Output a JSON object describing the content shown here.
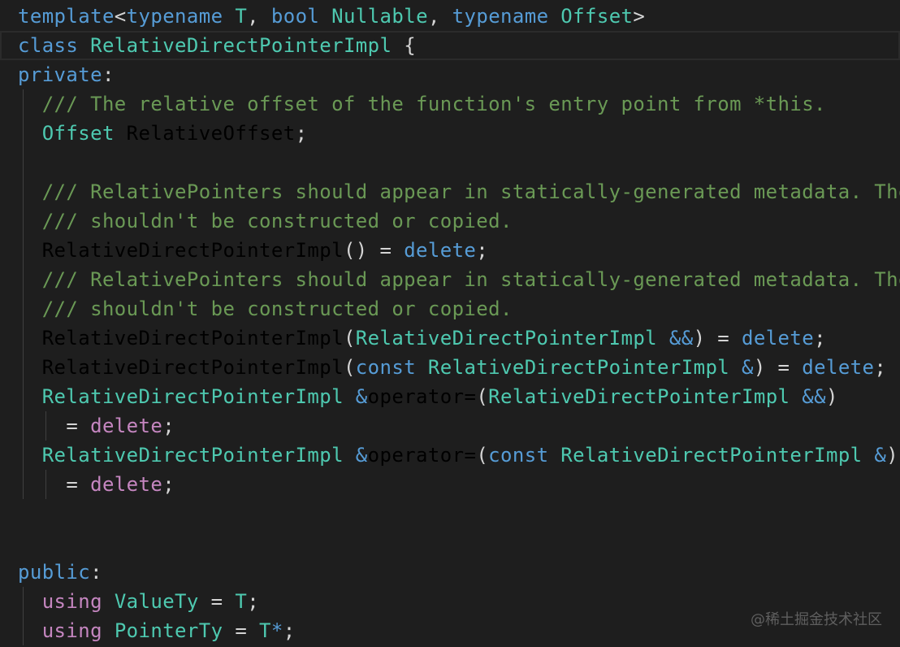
{
  "colors": {
    "background": "#1e1e1e",
    "keyword": "#569cd6",
    "type": "#4ec9b0",
    "text": "#d4d4d4",
    "comment": "#6a9955",
    "function": "#dcdcaa",
    "control": "#c586c0",
    "variable": "#9cdcfe",
    "guide": "#404040",
    "watermark": "#5f5f5f"
  },
  "watermark": "@稀土掘金技术社区",
  "code_lines": [
    {
      "indent": 0,
      "current": false,
      "tokens": [
        {
          "t": "template",
          "c": "keyword"
        },
        {
          "t": "<",
          "c": "text"
        },
        {
          "t": "typename",
          "c": "keyword"
        },
        {
          "t": " ",
          "c": "text"
        },
        {
          "t": "T",
          "c": "type"
        },
        {
          "t": ", ",
          "c": "text"
        },
        {
          "t": "bool",
          "c": "keyword"
        },
        {
          "t": " ",
          "c": "text"
        },
        {
          "t": "Nullable",
          "c": "type"
        },
        {
          "t": ", ",
          "c": "text"
        },
        {
          "t": "typename",
          "c": "keyword"
        },
        {
          "t": " ",
          "c": "text"
        },
        {
          "t": "Offset",
          "c": "type"
        },
        {
          "t": ">",
          "c": "text"
        }
      ]
    },
    {
      "indent": 0,
      "current": true,
      "tokens": [
        {
          "t": "class",
          "c": "keyword"
        },
        {
          "t": " ",
          "c": "text"
        },
        {
          "t": "RelativeDirectPointerImpl",
          "c": "type"
        },
        {
          "t": " {",
          "c": "text"
        }
      ]
    },
    {
      "indent": 0,
      "current": false,
      "tokens": [
        {
          "t": "private",
          "c": "keyword"
        },
        {
          "t": ":",
          "c": "text"
        }
      ]
    },
    {
      "indent": 1,
      "current": false,
      "tokens": [
        {
          "t": "/// The relative offset of the function's entry point from *this.",
          "c": "comment"
        }
      ]
    },
    {
      "indent": 1,
      "current": false,
      "tokens": [
        {
          "t": "Offset",
          "c": "type"
        },
        {
          "t": " ",
          "c": "text"
        },
        {
          "t": "RelativeOffset",
          "c": "variable"
        },
        {
          "t": ";",
          "c": "text"
        }
      ]
    },
    {
      "indent": 1,
      "current": false,
      "tokens": []
    },
    {
      "indent": 1,
      "current": false,
      "tokens": [
        {
          "t": "/// RelativePointers should appear in statically-generated metadata. They",
          "c": "comment"
        }
      ]
    },
    {
      "indent": 1,
      "current": false,
      "tokens": [
        {
          "t": "/// shouldn't be constructed or copied.",
          "c": "comment"
        }
      ]
    },
    {
      "indent": 1,
      "current": false,
      "tokens": [
        {
          "t": "RelativeDirectPointerImpl",
          "c": "function"
        },
        {
          "t": "() = ",
          "c": "text"
        },
        {
          "t": "delete",
          "c": "keyword"
        },
        {
          "t": ";",
          "c": "text"
        }
      ]
    },
    {
      "indent": 1,
      "current": false,
      "tokens": [
        {
          "t": "/// RelativePointers should appear in statically-generated metadata. They",
          "c": "comment"
        }
      ]
    },
    {
      "indent": 1,
      "current": false,
      "tokens": [
        {
          "t": "/// shouldn't be constructed or copied.",
          "c": "comment"
        }
      ]
    },
    {
      "indent": 1,
      "current": false,
      "tokens": [
        {
          "t": "RelativeDirectPointerImpl",
          "c": "function"
        },
        {
          "t": "(",
          "c": "text"
        },
        {
          "t": "RelativeDirectPointerImpl",
          "c": "type"
        },
        {
          "t": " ",
          "c": "text"
        },
        {
          "t": "&&",
          "c": "keyword"
        },
        {
          "t": ") = ",
          "c": "text"
        },
        {
          "t": "delete",
          "c": "keyword"
        },
        {
          "t": ";",
          "c": "text"
        }
      ]
    },
    {
      "indent": 1,
      "current": false,
      "tokens": [
        {
          "t": "RelativeDirectPointerImpl",
          "c": "function"
        },
        {
          "t": "(",
          "c": "text"
        },
        {
          "t": "const",
          "c": "keyword"
        },
        {
          "t": " ",
          "c": "text"
        },
        {
          "t": "RelativeDirectPointerImpl",
          "c": "type"
        },
        {
          "t": " ",
          "c": "text"
        },
        {
          "t": "&",
          "c": "keyword"
        },
        {
          "t": ") = ",
          "c": "text"
        },
        {
          "t": "delete",
          "c": "keyword"
        },
        {
          "t": ";",
          "c": "text"
        }
      ]
    },
    {
      "indent": 1,
      "current": false,
      "tokens": [
        {
          "t": "RelativeDirectPointerImpl",
          "c": "type"
        },
        {
          "t": " ",
          "c": "text"
        },
        {
          "t": "&",
          "c": "keyword"
        },
        {
          "t": "operator=",
          "c": "function"
        },
        {
          "t": "(",
          "c": "text"
        },
        {
          "t": "RelativeDirectPointerImpl",
          "c": "type"
        },
        {
          "t": " ",
          "c": "text"
        },
        {
          "t": "&&",
          "c": "keyword"
        },
        {
          "t": ")",
          "c": "text"
        }
      ]
    },
    {
      "indent": 2,
      "current": false,
      "tokens": [
        {
          "t": "= ",
          "c": "text"
        },
        {
          "t": "delete",
          "c": "control"
        },
        {
          "t": ";",
          "c": "text"
        }
      ]
    },
    {
      "indent": 1,
      "current": false,
      "tokens": [
        {
          "t": "RelativeDirectPointerImpl",
          "c": "type"
        },
        {
          "t": " ",
          "c": "text"
        },
        {
          "t": "&",
          "c": "keyword"
        },
        {
          "t": "operator=",
          "c": "function"
        },
        {
          "t": "(",
          "c": "text"
        },
        {
          "t": "const",
          "c": "keyword"
        },
        {
          "t": " ",
          "c": "text"
        },
        {
          "t": "RelativeDirectPointerImpl",
          "c": "type"
        },
        {
          "t": " ",
          "c": "text"
        },
        {
          "t": "&",
          "c": "keyword"
        },
        {
          "t": ")",
          "c": "text"
        }
      ]
    },
    {
      "indent": 2,
      "current": false,
      "tokens": [
        {
          "t": "= ",
          "c": "text"
        },
        {
          "t": "delete",
          "c": "control"
        },
        {
          "t": ";",
          "c": "text"
        }
      ]
    },
    {
      "indent": 0,
      "current": false,
      "tokens": []
    },
    {
      "indent": 0,
      "current": false,
      "tokens": []
    },
    {
      "indent": 0,
      "current": false,
      "tokens": [
        {
          "t": "public",
          "c": "keyword"
        },
        {
          "t": ":",
          "c": "text"
        }
      ]
    },
    {
      "indent": 1,
      "current": false,
      "tokens": [
        {
          "t": "using",
          "c": "control"
        },
        {
          "t": " ",
          "c": "text"
        },
        {
          "t": "ValueTy",
          "c": "type"
        },
        {
          "t": " = ",
          "c": "text"
        },
        {
          "t": "T",
          "c": "type"
        },
        {
          "t": ";",
          "c": "text"
        }
      ]
    },
    {
      "indent": 1,
      "current": false,
      "tokens": [
        {
          "t": "using",
          "c": "control"
        },
        {
          "t": " ",
          "c": "text"
        },
        {
          "t": "PointerTy",
          "c": "type"
        },
        {
          "t": " = ",
          "c": "text"
        },
        {
          "t": "T",
          "c": "type"
        },
        {
          "t": "*",
          "c": "keyword"
        },
        {
          "t": ";",
          "c": "text"
        }
      ]
    }
  ]
}
